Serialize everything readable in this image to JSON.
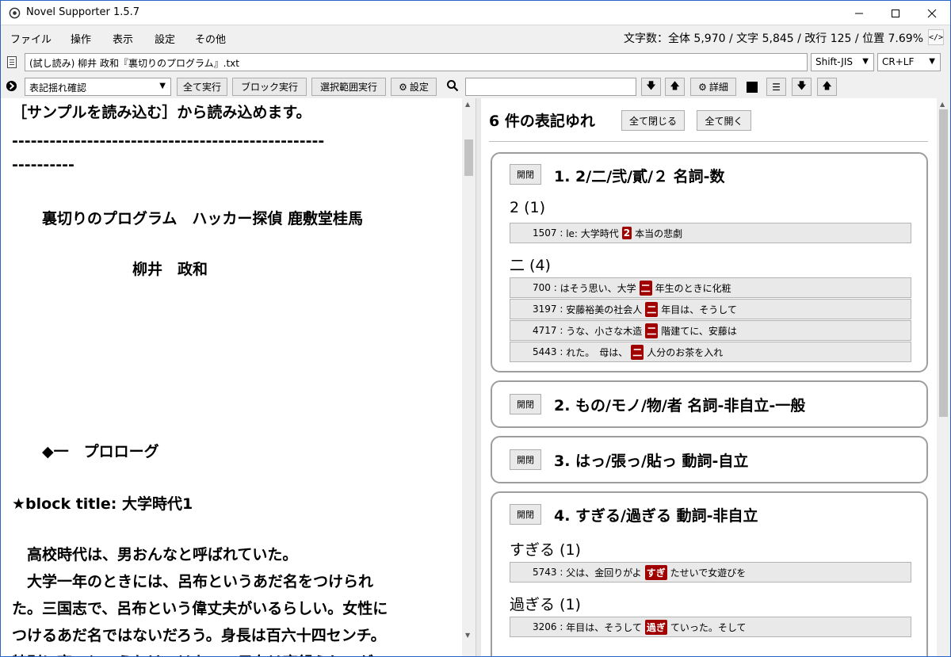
{
  "window": {
    "title": "Novel Supporter 1.5.7"
  },
  "menu": {
    "items": [
      "ファイル",
      "操作",
      "表示",
      "設定",
      "その他"
    ]
  },
  "stats": {
    "text": "文字数：全体 5,970 / 文字 5,845 / 改行 125 / 位置 7.69%",
    "code_button": "</>"
  },
  "file": {
    "path": "(試し読み) 柳井 政和『裏切りのプログラム』.txt",
    "encoding": "Shift-JIS",
    "line_ending": "CR+LF"
  },
  "toolbar": {
    "mode": "表記揺れ確認",
    "run_all": "全て実行",
    "run_block": "ブロック実行",
    "run_selection": "選択範囲実行",
    "settings": "設定",
    "search_value": "",
    "detail": "詳細"
  },
  "editor": {
    "lines": [
      "［サンプルを読み込む］から読み込めます。",
      "--------------------------------------------------",
      "----------",
      "",
      "　　裏切りのプログラム　ハッカー探偵 鹿敷堂桂馬",
      "",
      "　　　　　　　　柳井　政和",
      "",
      "",
      "",
      "",
      "",
      "",
      "　　◆一　プロローグ",
      "",
      "★block title: 大学時代1",
      "",
      "　高校時代は、男おんなと呼ばれていた。",
      "　大学一年のときには、呂布というあだ名をつけられ",
      "た。三国志で、呂布という偉丈夫がいるらしい。女性に",
      "つけるあだ名ではないだろう。身長は百六十四センチ。",
      "特別に高いというわけではない。只存は高鍋らしいが"
    ]
  },
  "panel": {
    "header": "6 件の表記ゆれ",
    "collapse_all": "全て閉じる",
    "expand_all": "全て開く",
    "open_label": "開閉",
    "cards": [
      {
        "title": "1. 2/二/弐/貳/２ 名詞-数",
        "groups": [
          {
            "label": "2 (1)",
            "rows": [
              {
                "num": "1507",
                "before": "le: 大学時代",
                "hl": "2",
                "after": "本当の悲劇"
              }
            ]
          },
          {
            "label": "二 (4)",
            "rows": [
              {
                "num": "700",
                "before": "はそう思い、大学",
                "hl": "二",
                "after": "年生のときに化粧"
              },
              {
                "num": "3197",
                "before": "安藤裕美の社会人",
                "hl": "二",
                "after": "年目は、そうして"
              },
              {
                "num": "4717",
                "before": "うな、小さな木造",
                "hl": "二",
                "after": "階建てに、安藤は"
              },
              {
                "num": "5443",
                "before": "れた。　母は、",
                "hl": "二",
                "after": "人分のお茶を入れ"
              }
            ]
          }
        ]
      },
      {
        "title": "2. もの/モノ/物/者 名詞-非自立-一般",
        "groups": []
      },
      {
        "title": "3. はっ/張っ/貼っ 動詞-自立",
        "groups": []
      },
      {
        "title": "4. すぎる/過ぎる 動詞-非自立",
        "groups": [
          {
            "label": "すぎる (1)",
            "rows": [
              {
                "num": "5743",
                "before": "父は、金回りがよ",
                "hl": "すぎ",
                "after": "たせいで女遊びを"
              }
            ]
          },
          {
            "label": "過ぎる (1)",
            "rows": [
              {
                "num": "3206",
                "before": "年目は、そうして",
                "hl": "過ぎ",
                "after": "ていった。そして"
              }
            ]
          }
        ]
      }
    ]
  },
  "colors": {
    "highlight": "#a10000",
    "window_border": "#2a63c9"
  }
}
